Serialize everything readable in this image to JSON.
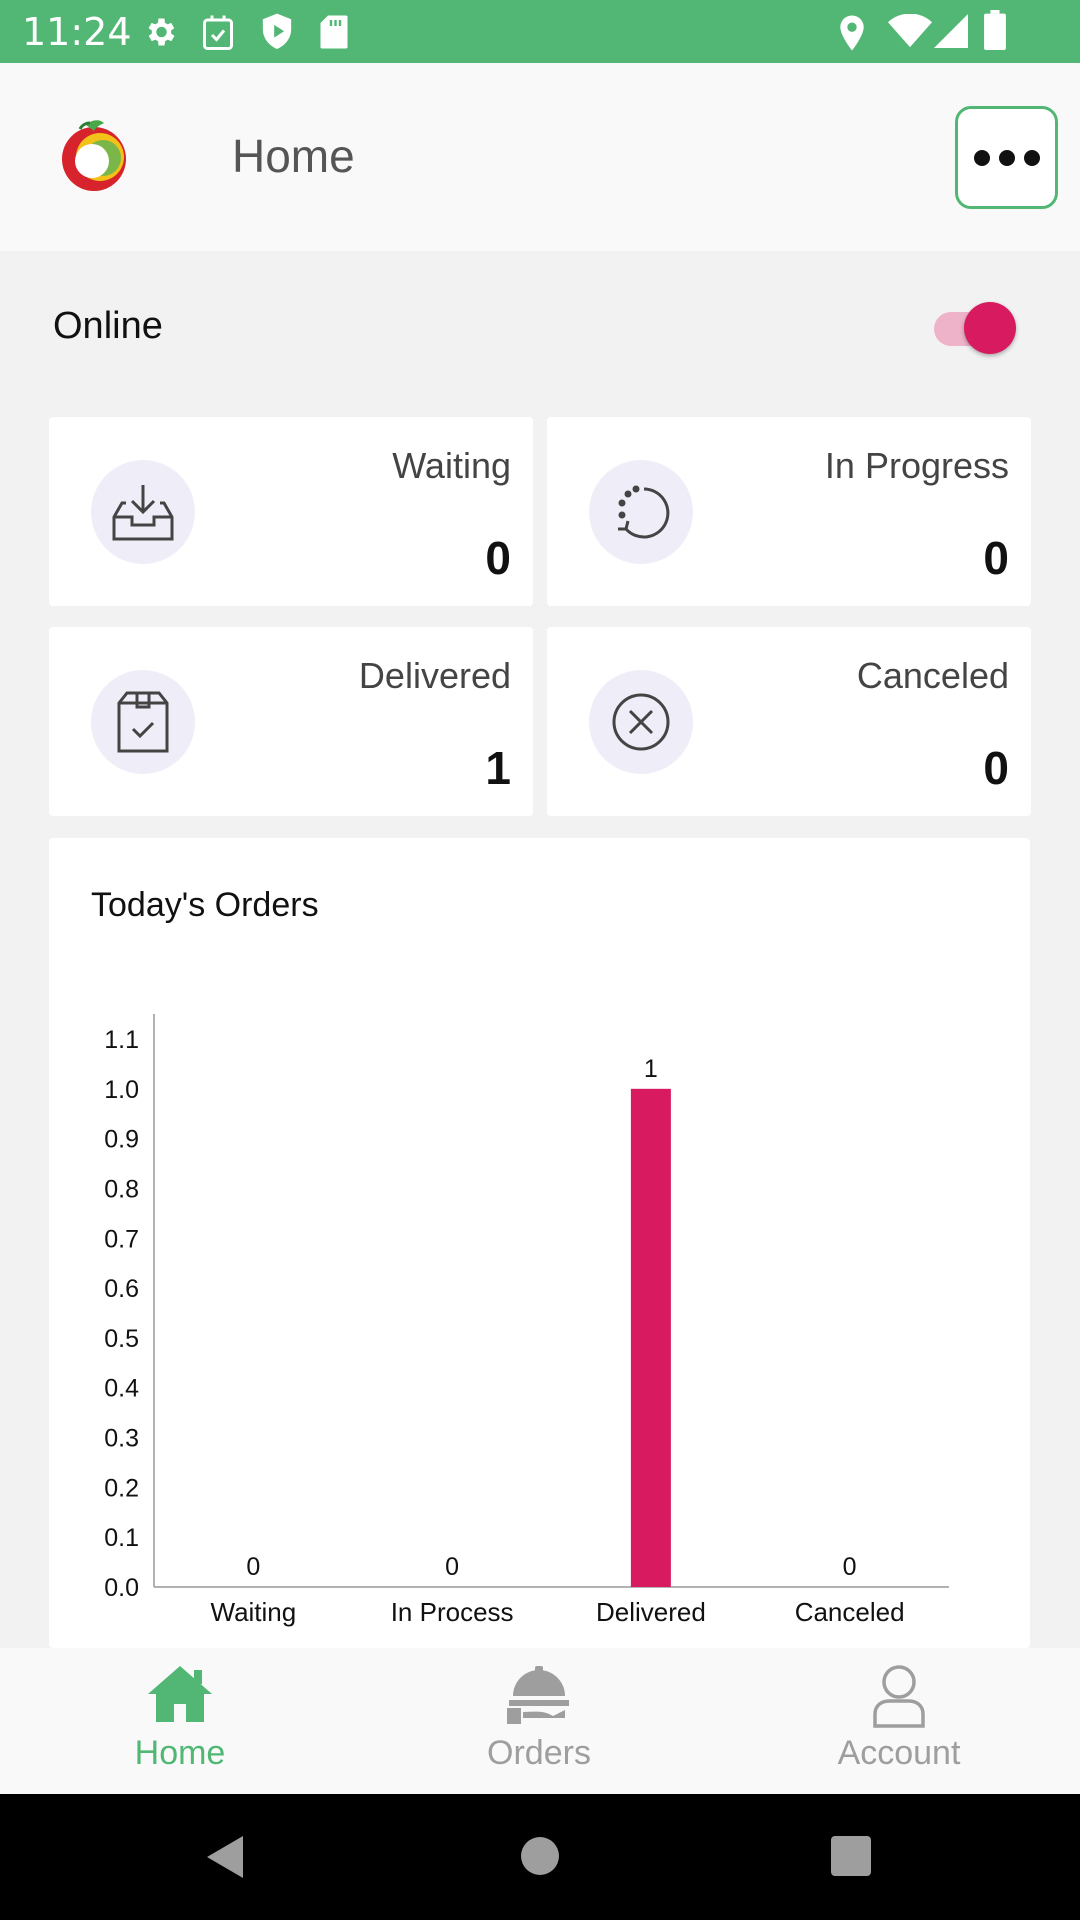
{
  "status_bar": {
    "time": "11:24"
  },
  "header": {
    "title": "Home"
  },
  "online": {
    "label": "Online",
    "enabled": true
  },
  "stats": [
    {
      "label": "Waiting",
      "count": "0",
      "icon": "inbox-download-icon"
    },
    {
      "label": "In Progress",
      "count": "0",
      "icon": "progress-rotate-icon"
    },
    {
      "label": "Delivered",
      "count": "1",
      "icon": "package-check-icon"
    },
    {
      "label": "Canceled",
      "count": "0",
      "icon": "cancel-circle-icon"
    }
  ],
  "chart_section": {
    "title": "Today's Orders"
  },
  "chart_data": {
    "type": "bar",
    "title": "Today's Orders",
    "categories": [
      "Waiting",
      "In Process",
      "Delivered",
      "Canceled"
    ],
    "values": [
      0,
      0,
      1,
      0
    ],
    "data_labels": [
      "0",
      "0",
      "1",
      "0"
    ],
    "ylim": [
      0,
      1.1
    ],
    "yticks": [
      "0.0",
      "0.1",
      "0.2",
      "0.3",
      "0.4",
      "0.5",
      "0.6",
      "0.7",
      "0.8",
      "0.9",
      "1.0",
      "1.1"
    ],
    "bar_color": "#d81b60",
    "grid": false
  },
  "bottom_nav": {
    "items": [
      {
        "label": "Home",
        "icon": "home-icon",
        "active": true
      },
      {
        "label": "Orders",
        "icon": "food-tray-icon",
        "active": false
      },
      {
        "label": "Account",
        "icon": "user-icon",
        "active": false
      }
    ]
  },
  "colors": {
    "brand_green": "#52b774",
    "accent": "#d81b60",
    "inactive": "#9e9e9e"
  }
}
